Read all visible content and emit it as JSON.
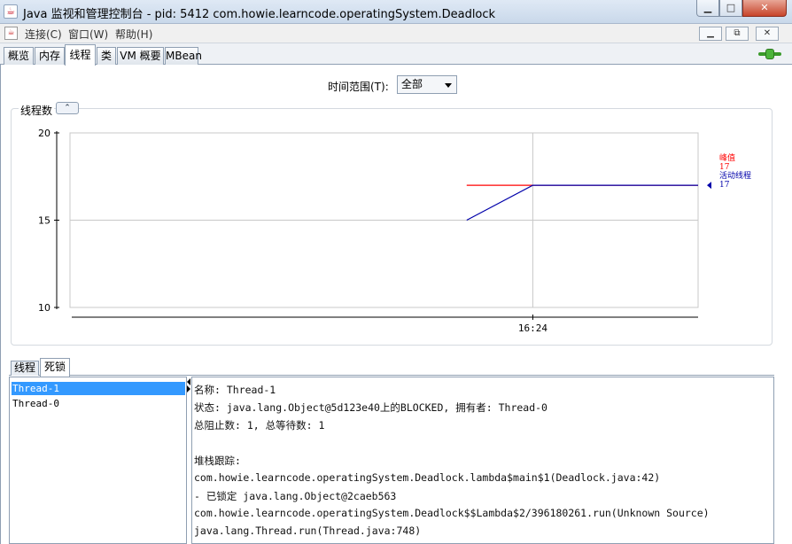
{
  "window": {
    "title": "Java 监视和管理控制台 - pid: 5412 com.howie.learncode.operatingSystem.Deadlock",
    "minimize_glyph": "▁",
    "maximize_glyph": "□",
    "close_glyph": "✕"
  },
  "menubar": {
    "items": [
      "连接(C)",
      "窗口(W)",
      "帮助(H)"
    ],
    "inner_buttons": [
      "▁",
      "⧉",
      "✕"
    ]
  },
  "tabs": [
    {
      "label": "概览",
      "active": false
    },
    {
      "label": "内存",
      "active": false
    },
    {
      "label": "线程",
      "active": true
    },
    {
      "label": "类",
      "active": false
    },
    {
      "label": "VM 概要",
      "active": false
    },
    {
      "label": "MBean",
      "active": false
    }
  ],
  "time_range": {
    "label": "时间范围(T):",
    "selected": "全部"
  },
  "chart_panel": {
    "title": "线程数",
    "collapse_glyph": "⌃"
  },
  "chart_data": {
    "type": "line",
    "title": "线程数",
    "xlabel": "",
    "ylabel": "",
    "ylim": [
      10,
      20
    ],
    "yticks": [
      10,
      15,
      20
    ],
    "xticks": [
      "16:24"
    ],
    "grid": true,
    "series": [
      {
        "name": "峰值",
        "color": "#ff0000",
        "value_label": "17",
        "points": [
          [
            -2,
            17
          ],
          [
            0,
            17
          ],
          [
            5,
            17
          ]
        ]
      },
      {
        "name": "活动线程",
        "color": "#0000aa",
        "value_label": "17",
        "points": [
          [
            -2,
            15
          ],
          [
            0,
            17
          ],
          [
            5,
            17
          ]
        ]
      }
    ]
  },
  "lower_tabs": [
    {
      "label": "线程",
      "active": false
    },
    {
      "label": "死锁",
      "active": true
    }
  ],
  "thread_list": [
    {
      "name": "Thread-1",
      "selected": true
    },
    {
      "name": "Thread-0",
      "selected": false
    }
  ],
  "detail_lines": [
    "名称: Thread-1",
    "状态: java.lang.Object@5d123e40上的BLOCKED, 拥有者: Thread-0",
    "总阻止数: 1, 总等待数: 1",
    "",
    "堆栈跟踪:",
    "com.howie.learncode.operatingSystem.Deadlock.lambda$main$1(Deadlock.java:42)",
    "   - 已锁定 java.lang.Object@2caeb563",
    "com.howie.learncode.operatingSystem.Deadlock$$Lambda$2/396180261.run(Unknown Source)",
    "java.lang.Thread.run(Thread.java:748)"
  ]
}
